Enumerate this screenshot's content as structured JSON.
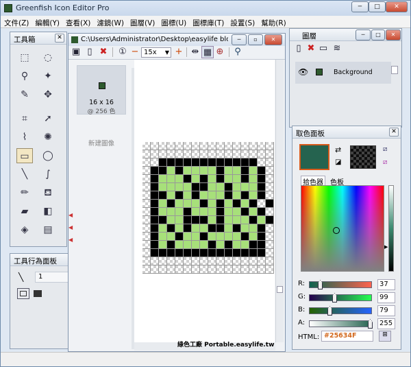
{
  "window": {
    "title": "Greenfish Icon Editor Pro",
    "min": "─",
    "max": "□",
    "close": "✕"
  },
  "menu": [
    "文件(Z)",
    "編輯(Y)",
    "查看(X)",
    "濾鏡(W)",
    "圖層(V)",
    "圖標(U)",
    "圖標庫(T)",
    "設置(S)",
    "幫助(R)"
  ],
  "toolbox": {
    "title": "工具箱",
    "close": "✕",
    "tools": [
      {
        "name": "rect-select-icon",
        "glyph": "⬚"
      },
      {
        "name": "ellipse-select-icon",
        "glyph": "◌"
      },
      {
        "name": "lasso-icon",
        "glyph": "⚲"
      },
      {
        "name": "magic-wand-icon",
        "glyph": "✦"
      },
      {
        "name": "brush-select-icon",
        "glyph": "✎"
      },
      {
        "name": "move-icon",
        "glyph": "✥"
      },
      {
        "name": "crop-icon",
        "glyph": "⌗"
      },
      {
        "name": "pointer-icon",
        "glyph": "➚"
      },
      {
        "name": "eyedropper-icon",
        "glyph": "⌇"
      },
      {
        "name": "spray-icon",
        "glyph": "✺"
      },
      {
        "name": "rectangle-icon",
        "glyph": "▭"
      },
      {
        "name": "ellipse-icon",
        "glyph": "◯"
      },
      {
        "name": "line-icon",
        "glyph": "╲"
      },
      {
        "name": "curve-icon",
        "glyph": "∫"
      },
      {
        "name": "pencil-icon",
        "glyph": "✏"
      },
      {
        "name": "paint-bucket-icon",
        "glyph": "⛾"
      },
      {
        "name": "eraser-icon",
        "glyph": "▰"
      },
      {
        "name": "clone-icon",
        "glyph": "◧"
      },
      {
        "name": "blur-icon",
        "glyph": "◈"
      },
      {
        "name": "gradient-icon",
        "glyph": "▤"
      }
    ]
  },
  "toolbehavior": {
    "title": "工具行為面板",
    "close": "✕",
    "size": "1"
  },
  "document": {
    "title": "C:\\Users\\Administrator\\Desktop\\easylife blog\\f...",
    "zoom": "15x",
    "thumb_size": "16 x 16",
    "thumb_colors": "@ 256 色",
    "new_image": "新建圖像"
  },
  "layers": {
    "title": "圖層",
    "items": [
      {
        "name": "Background"
      }
    ]
  },
  "colorpanel": {
    "title": "取色面板",
    "close": "✕",
    "tab_picker": "拾色器",
    "tab_palette": "色板",
    "primary": "#25634F",
    "r_label": "R:",
    "g_label": "G:",
    "b_label": "B:",
    "a_label": "A:",
    "html_label": "HTML:",
    "r": "37",
    "g": "99",
    "b": "79",
    "a": "255",
    "html": "#25634F",
    "r_level": 0.145,
    "g_level": 0.388,
    "b_level": 0.31,
    "a_level": 1.0
  },
  "watermark": "綠色工廠 Portable.easylife.tw",
  "pattern": [
    "................",
    "................",
    "..############..",
    ".##G#GGGG#GG#G#.",
    ".#GGG#G#G#GG#G#.",
    ".#GGGG##GG#GGG#.",
    ".##G#G#GGG#G#G#.",
    ".#G#GGG#G#G#G#.#",
    ".#GGG#GGG#GG#G#.",
    ".##GG###G#GGG#G#",
    ".#G#G#GG##G#GG#.",
    ".#GG#GG#GGGG#G#.",
    ".#G#GGGG#G#GG##.",
    ".##############.",
    "................",
    "................"
  ]
}
